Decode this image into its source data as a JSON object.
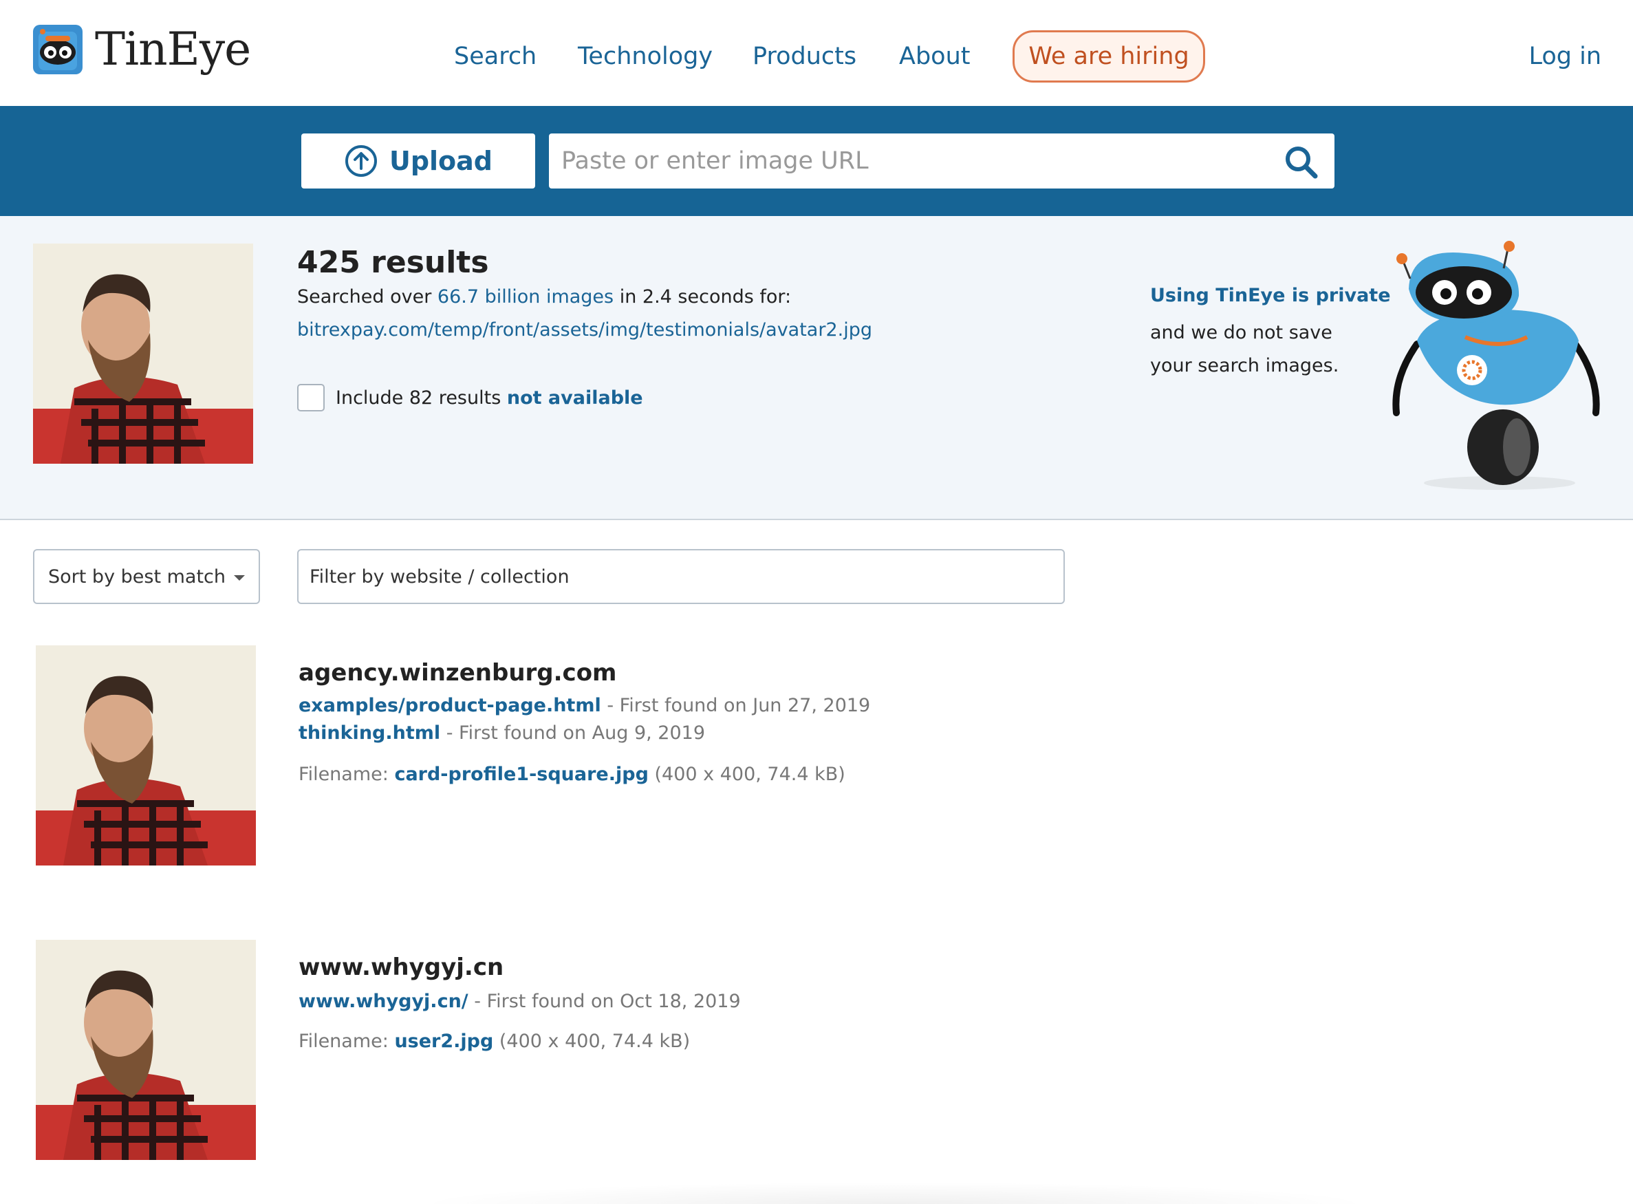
{
  "header": {
    "logo_text": "TinEye",
    "nav": [
      {
        "label": "Search"
      },
      {
        "label": "Technology"
      },
      {
        "label": "Products"
      },
      {
        "label": "About"
      }
    ],
    "hiring_label": "We are hiring",
    "login_label": "Log in"
  },
  "search": {
    "upload_label": "Upload",
    "url_placeholder": "Paste or enter image URL",
    "url_value": ""
  },
  "summary": {
    "count_text": "425 results",
    "searched_prefix": "Searched over ",
    "searched_link": "66.7 billion images",
    "searched_suffix": " in 2.4 seconds for:",
    "query_url": "bitrexpay.com/temp/front/assets/img/testimonials/avatar2.jpg",
    "include_prefix": "Include 82 results ",
    "include_link": "not available",
    "private_title": "Using TinEye is private",
    "private_text": "and we do not save your search images."
  },
  "filters": {
    "sort_label": "Sort by best match",
    "filter_placeholder": "Filter by website / collection"
  },
  "results": [
    {
      "domain": "agency.winzenburg.com",
      "matches": [
        {
          "page": "examples/product-page.html",
          "found": " - First found on Jun 27, 2019"
        },
        {
          "page": "thinking.html",
          "found": " - First found on Aug 9, 2019"
        }
      ],
      "filename_label": "Filename: ",
      "filename": "card-profile1-square.jpg",
      "file_info": " (400 x 400, 74.4 kB)"
    },
    {
      "domain": "www.whygyj.cn",
      "matches": [
        {
          "page": "www.whygyj.cn/",
          "found": " - First found on Oct 18, 2019"
        }
      ],
      "filename_label": "Filename: ",
      "filename": "user2.jpg",
      "file_info": " (400 x 400, 74.4 kB)"
    }
  ],
  "colors": {
    "brand_blue": "#166495",
    "link_blue": "#1a6496",
    "hiring_orange": "#e07a4f",
    "summary_bg": "#f2f6fa"
  }
}
